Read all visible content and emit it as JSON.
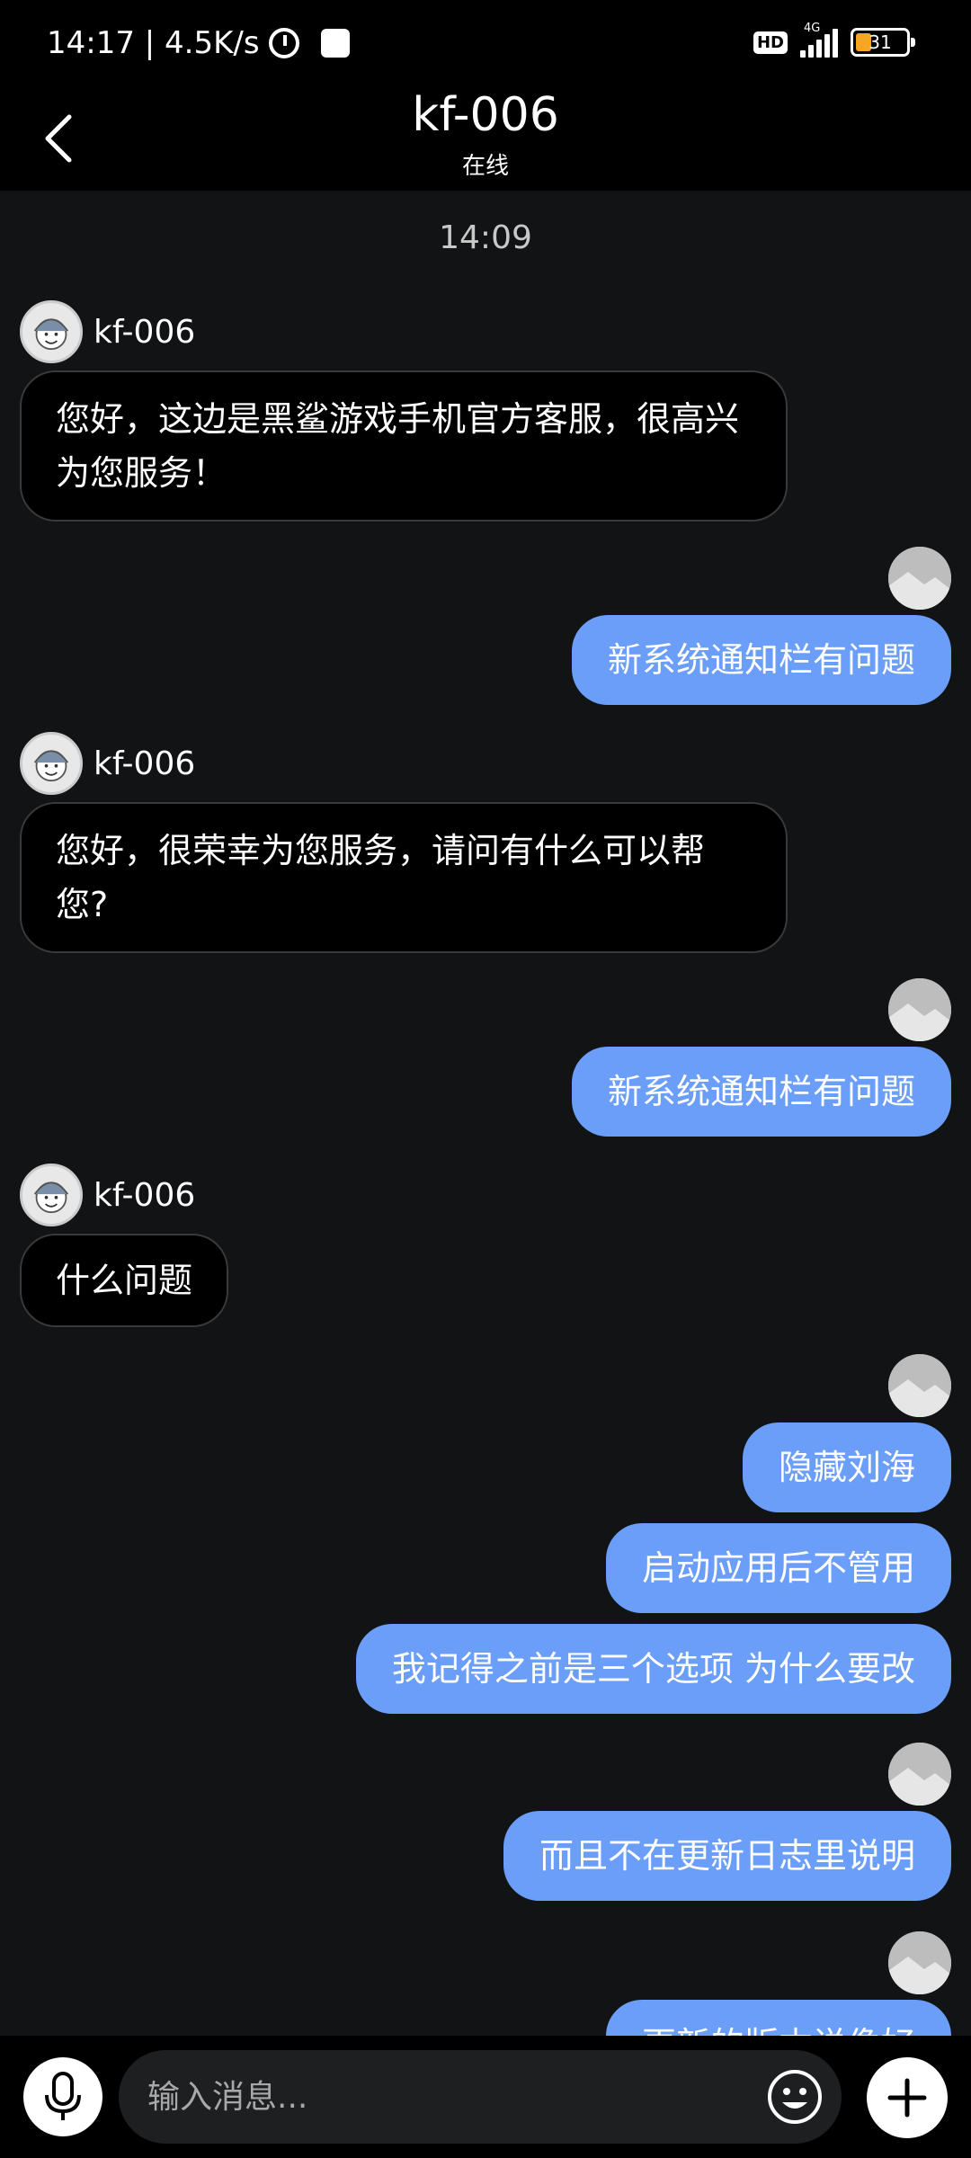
{
  "status_bar": {
    "time_speed": "14:17 | 4.5K/s",
    "hd": "HD",
    "network": "4G",
    "battery": "31",
    "battery_level": 0.31,
    "battery_color": "#f5a623"
  },
  "header": {
    "title": "kf-006",
    "subtitle": "在线",
    "back_icon": "chevron-left-icon"
  },
  "chat": {
    "timestamp": "14:09",
    "agent_name": "kf-006",
    "agent_bubble_color": "#000000",
    "user_bubble_color": "#6a9ef8",
    "messages": [
      {
        "from": "agent",
        "text": "您好，这边是黑鲨游戏手机官方客服，很高兴为您服务！"
      },
      {
        "from": "user",
        "text": "新系统通知栏有问题"
      },
      {
        "from": "agent",
        "text": "您好，很荣幸为您服务，请问有什么可以帮您?"
      },
      {
        "from": "user",
        "text": "新系统通知栏有问题"
      },
      {
        "from": "agent",
        "text": "什么问题"
      },
      {
        "from": "user",
        "text": "隐藏刘海"
      },
      {
        "from": "user",
        "text": "启动应用后不管用"
      },
      {
        "from": "user",
        "text": "我记得之前是三个选项 为什么要改"
      },
      {
        "from": "user",
        "text": "而且不在更新日志里说明"
      },
      {
        "from": "user",
        "text": "更新的版本说像好"
      }
    ]
  },
  "input_bar": {
    "placeholder": "输入消息...",
    "mic_icon": "microphone-icon",
    "emoji_icon": "emoji-icon",
    "plus_icon": "plus-icon"
  }
}
